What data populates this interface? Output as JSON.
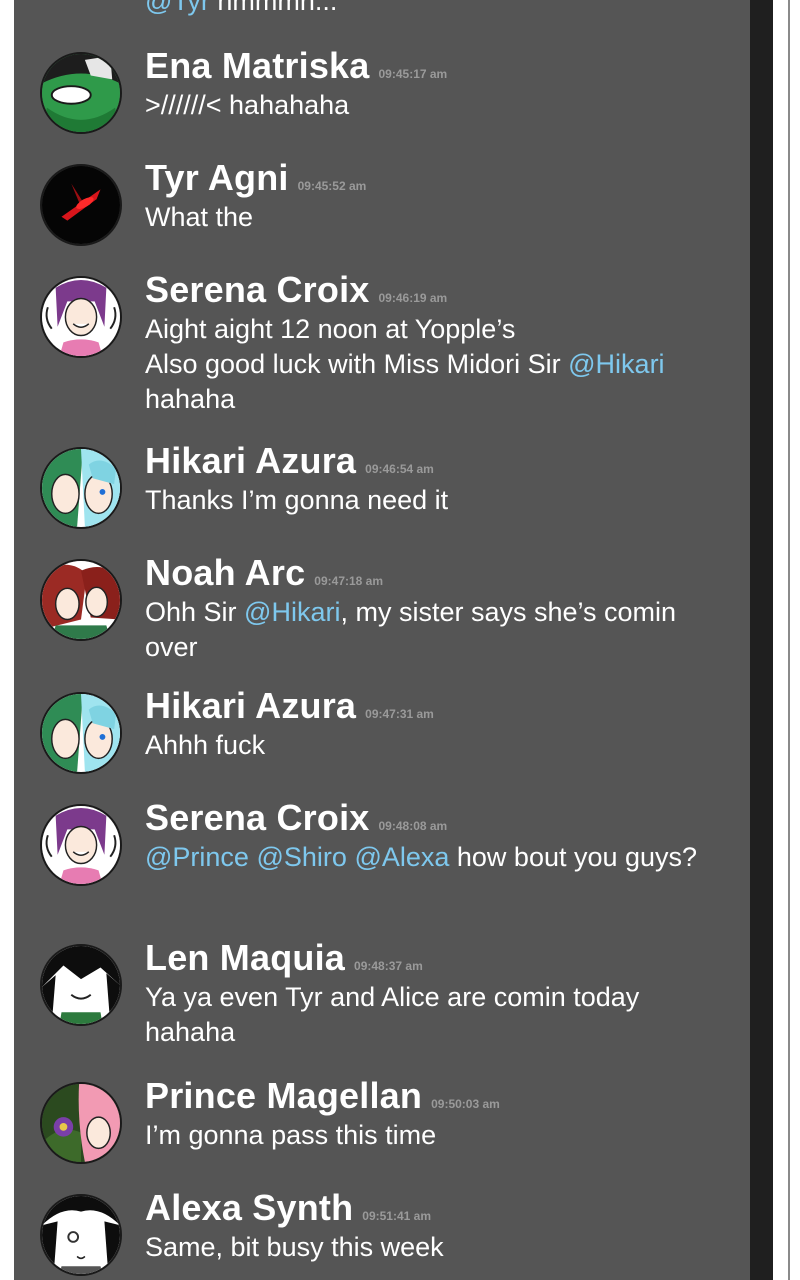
{
  "colors": {
    "panel": "#555555",
    "mention": "#7ec8ee",
    "timestamp": "#9a9a9a",
    "text": "#ffffff",
    "divider": "#1f1f1f"
  },
  "previous_message": {
    "mention": "@Tyr",
    "text": " hmmmn..."
  },
  "messages": [
    {
      "name": "Ena Matriska",
      "time": "09:45:17 am",
      "lines": [
        ">//////< hahahaha"
      ]
    },
    {
      "name": "Tyr Agni",
      "time": "09:45:52 am",
      "lines": [
        "What the"
      ]
    },
    {
      "name": "Serena Croix",
      "time": "09:46:19 am",
      "lines": [
        "Aight aight 12 noon at Yopple’s",
        "Also good luck with Miss Midori Sir ",
        "hahaha"
      ],
      "mentions": [
        "@Hikari"
      ]
    },
    {
      "name": "Hikari Azura",
      "time": "09:46:54 am",
      "lines": [
        "Thanks I’m gonna need it"
      ]
    },
    {
      "name": "Noah Arc",
      "time": "09:47:18 am",
      "lines": [
        "Ohh Sir ",
        ", my sister says she’s comin over"
      ],
      "mentions": [
        "@Hikari"
      ]
    },
    {
      "name": "Hikari Azura",
      "time": "09:47:31 am",
      "lines": [
        "Ahhh fuck"
      ]
    },
    {
      "name": "Serena Croix",
      "time": "09:48:08 am",
      "lines": [
        " how bout you guys?"
      ],
      "mentions": [
        "@Prince",
        "@Shiro",
        "@Alexa"
      ]
    },
    {
      "name": "Len Maquia",
      "time": "09:48:37 am",
      "lines": [
        "Ya ya even Tyr and Alice are comin today hahaha"
      ]
    },
    {
      "name": "Prince Magellan",
      "time": "09:50:03 am",
      "lines": [
        "I’m gonna pass this time"
      ]
    },
    {
      "name": "Alexa Synth",
      "time": "09:51:41 am",
      "lines": [
        "Same, bit busy this week"
      ]
    }
  ],
  "avatars": [
    "ena-avatar",
    "tyr-avatar",
    "serena-avatar",
    "hikari-avatar",
    "noah-avatar",
    "hikari-avatar",
    "serena-avatar",
    "len-avatar",
    "prince-avatar",
    "alexa-avatar"
  ]
}
